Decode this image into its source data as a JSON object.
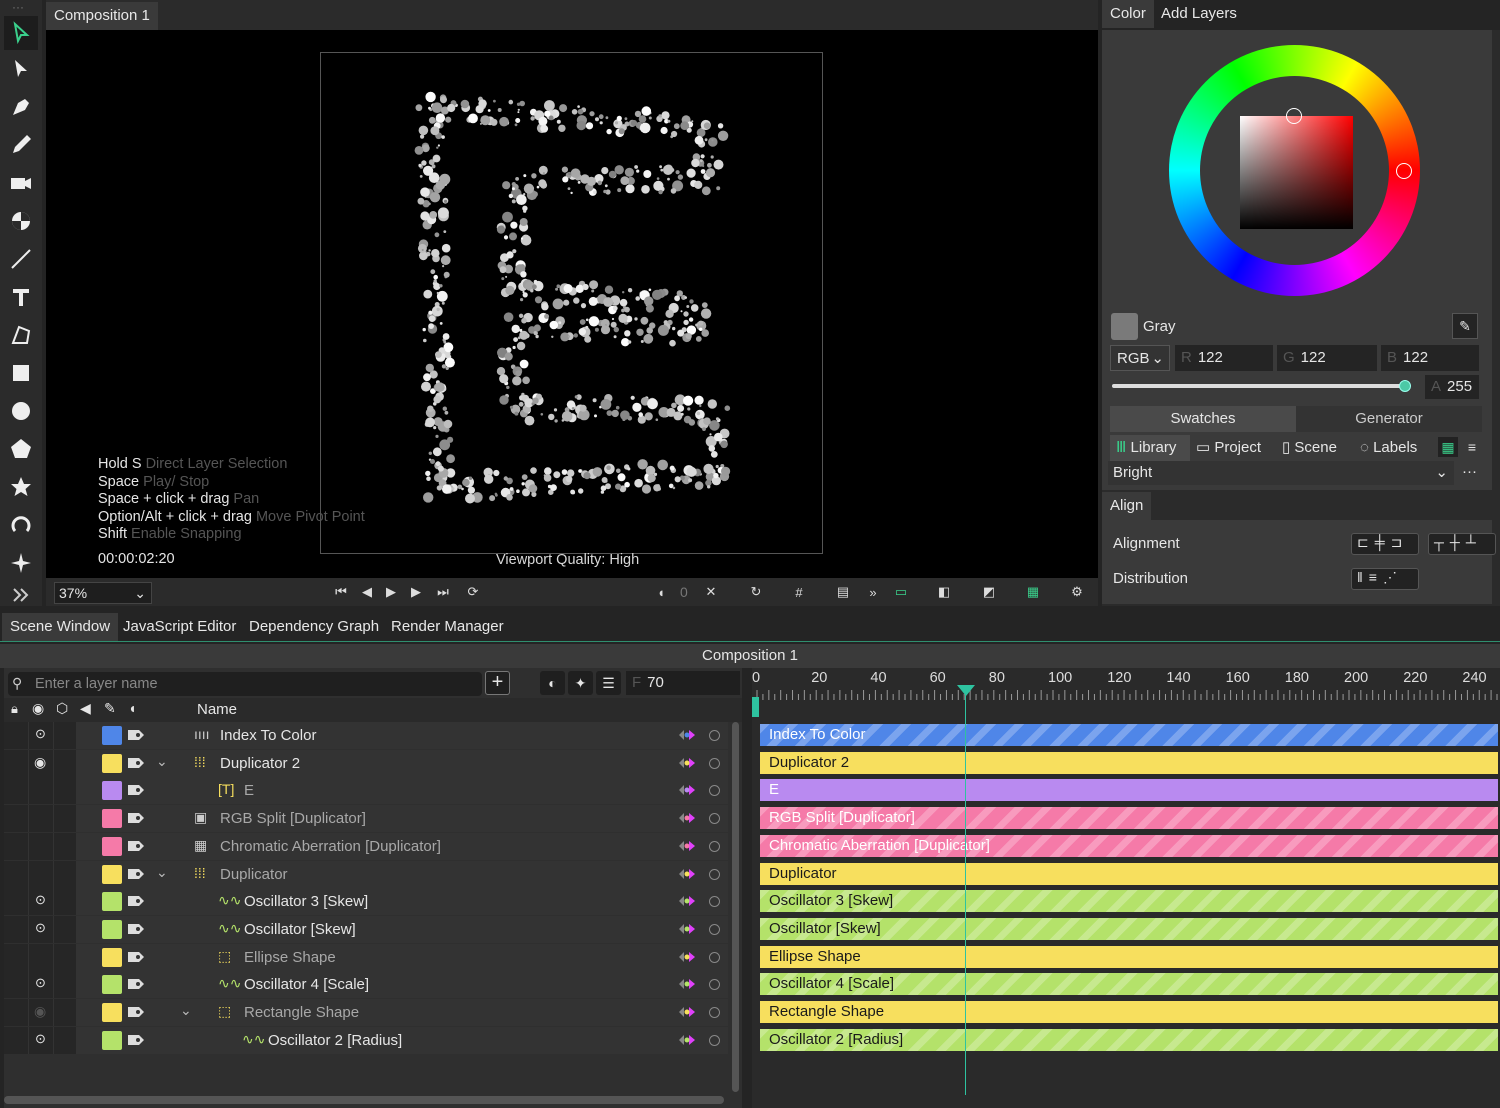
{
  "viewport": {
    "tab": "Composition 1",
    "hints": [
      {
        "key": "Hold S",
        "desc": "Direct Layer Selection"
      },
      {
        "key": "Space",
        "desc": "Play/ Stop"
      },
      {
        "key": "Space + click + drag",
        "desc": "Pan"
      },
      {
        "key": "Option/Alt + click + drag",
        "desc": "Move Pivot Point"
      },
      {
        "key": "Shift",
        "desc": "Enable Snapping"
      }
    ],
    "timecode": "00:00:02:20",
    "quality": "Viewport Quality: High",
    "zoom": "37%",
    "frame_counter": "0"
  },
  "right_panel": {
    "tabs": [
      "Color",
      "Add Layers"
    ],
    "color_name": "Gray",
    "mode": "RGB",
    "r_key": "R",
    "r": "122",
    "g_key": "G",
    "g": "122",
    "b_key": "B",
    "b": "122",
    "a_key": "A",
    "a": "255",
    "swatch_tabs": [
      "Swatches",
      "Generator"
    ],
    "library_tabs": [
      "Library",
      "Project",
      "Scene",
      "Labels"
    ],
    "palette": "Bright",
    "more": "···",
    "align_title": "Align",
    "alignment_label": "Alignment",
    "distribution_label": "Distribution",
    "swatch_color": "#7a7a7a"
  },
  "bottom": {
    "tabs": [
      "Scene Window",
      "JavaScript Editor",
      "Dependency Graph",
      "Render Manager"
    ],
    "comp_title": "Composition 1",
    "search_placeholder": "Enter a layer name",
    "frame_key": "F",
    "frame": "70",
    "name_header": "Name",
    "ruler": [
      "0",
      "20",
      "40",
      "60",
      "80",
      "100",
      "120",
      "140",
      "160",
      "180",
      "200",
      "220",
      "240"
    ],
    "layers": [
      {
        "name": "Index To Color",
        "color": "#4f86e8",
        "icon": "index-icon",
        "dim": false,
        "check": true,
        "eye": false,
        "indent": 0,
        "chev": false,
        "bar": "#4f86e8",
        "stripe": true
      },
      {
        "name": "Duplicator 2",
        "color": "#f7df5e",
        "icon": "duplicator-icon",
        "dim": false,
        "check": false,
        "eye": true,
        "indent": 0,
        "chev": true,
        "bar": "#f7df5e",
        "stripe": false
      },
      {
        "name": "E",
        "color": "#b98af0",
        "icon": "text-layer-icon",
        "dim": true,
        "check": false,
        "eye": false,
        "indent": 1,
        "chev": false,
        "bar": "#b98af0",
        "stripe": false
      },
      {
        "name": "RGB Split [Duplicator]",
        "color": "#f57aa8",
        "icon": "rgb-split-icon",
        "dim": true,
        "check": false,
        "eye": false,
        "indent": 0,
        "chev": false,
        "bar": "#f57aa8",
        "stripe": true
      },
      {
        "name": "Chromatic Aberration [Duplicator]",
        "color": "#f57aa8",
        "icon": "chromatic-icon",
        "dim": true,
        "check": false,
        "eye": false,
        "indent": 0,
        "chev": false,
        "bar": "#f57aa8",
        "stripe": true
      },
      {
        "name": "Duplicator",
        "color": "#f7df5e",
        "icon": "duplicator-icon",
        "dim": true,
        "check": false,
        "eye": false,
        "indent": 0,
        "chev": true,
        "bar": "#f7df5e",
        "stripe": false
      },
      {
        "name": "Oscillator 3 [Skew]",
        "color": "#b4e26a",
        "icon": "oscillator-icon",
        "dim": false,
        "check": true,
        "eye": false,
        "indent": 1,
        "chev": false,
        "bar": "#b4e26a",
        "stripe": true
      },
      {
        "name": "Oscillator [Skew]",
        "color": "#b4e26a",
        "icon": "oscillator-icon",
        "dim": false,
        "check": true,
        "eye": false,
        "indent": 1,
        "chev": false,
        "bar": "#b4e26a",
        "stripe": true
      },
      {
        "name": "Ellipse Shape",
        "color": "#f7df5e",
        "icon": "shape-icon",
        "dim": true,
        "check": false,
        "eye": false,
        "indent": 1,
        "chev": false,
        "bar": "#f7df5e",
        "stripe": false
      },
      {
        "name": "Oscillator 4 [Scale]",
        "color": "#b4e26a",
        "icon": "oscillator-icon",
        "dim": false,
        "check": true,
        "eye": false,
        "indent": 1,
        "chev": false,
        "bar": "#b4e26a",
        "stripe": true
      },
      {
        "name": "Rectangle Shape",
        "color": "#f7df5e",
        "icon": "shape-icon",
        "dim": true,
        "check": false,
        "eye": "dim",
        "indent": 1,
        "chev": true,
        "bar": "#f7df5e",
        "stripe": false
      },
      {
        "name": "Oscillator 2 [Radius]",
        "color": "#b4e26a",
        "icon": "oscillator-icon",
        "dim": false,
        "check": true,
        "eye": false,
        "indent": 2,
        "chev": false,
        "bar": "#b4e26a",
        "stripe": true
      }
    ]
  }
}
